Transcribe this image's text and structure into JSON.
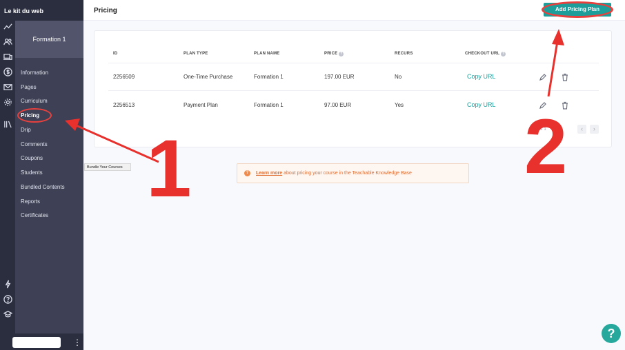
{
  "app": {
    "brand": "Le kit du web"
  },
  "course": {
    "name": "Formation 1"
  },
  "nav": {
    "items": [
      {
        "label": "Information"
      },
      {
        "label": "Pages"
      },
      {
        "label": "Curriculum"
      },
      {
        "label": "Pricing",
        "active": true
      },
      {
        "label": "Drip"
      },
      {
        "label": "Comments"
      },
      {
        "label": "Coupons"
      },
      {
        "label": "Students"
      },
      {
        "label": "Bundled Contents"
      },
      {
        "label": "Reports"
      },
      {
        "label": "Certificates"
      }
    ]
  },
  "rail_icons": [
    "trend-icon",
    "users-icon",
    "devices-icon",
    "dollar-icon",
    "mail-icon",
    "gear-icon",
    "library-icon",
    "bolt-icon",
    "help-icon",
    "graduation-icon"
  ],
  "header": {
    "title": "Pricing",
    "add_button": "Add Pricing Plan"
  },
  "table": {
    "columns": [
      "ID",
      "PLAN TYPE",
      "PLAN NAME",
      "PRICE",
      "RECURS",
      "CHECKOUT URL"
    ],
    "rows": [
      {
        "id": "2256509",
        "plan_type": "One-Time Purchase",
        "plan_name": "Formation 1",
        "price": "197.00 EUR",
        "recurs": "No",
        "checkout": "Copy URL"
      },
      {
        "id": "2256513",
        "plan_type": "Payment Plan",
        "plan_name": "Formation 1",
        "price": "97.00 EUR",
        "recurs": "Yes",
        "checkout": "Copy URL"
      }
    ],
    "pagination_text": "ing 1 of 1"
  },
  "banner": {
    "link": "Learn more",
    "text": " about pricing your course in the Teachable Knowledge Base"
  },
  "tooltip": "Bundle Your Courses",
  "help_fab": "?",
  "annotations": {
    "step1": "1",
    "step2": "2"
  },
  "colors": {
    "accent": "#1e9e9a",
    "annotation": "#e8312d",
    "sidebar": "#3e4156",
    "rail": "#2b2e3f"
  }
}
